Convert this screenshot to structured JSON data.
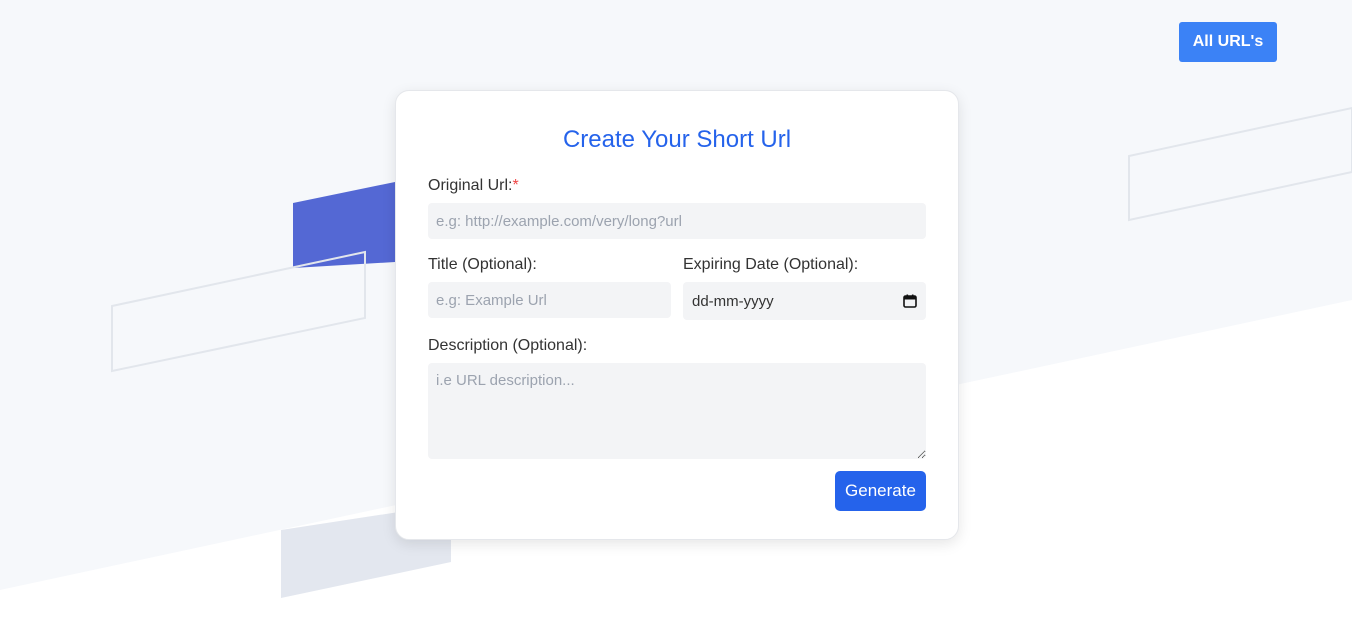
{
  "header": {
    "all_urls_label": "All URL's"
  },
  "form": {
    "title": "Create Your Short Url",
    "original_url": {
      "label": "Original Url:",
      "required_mark": "*",
      "placeholder": "e.g: http://example.com/very/long?url",
      "value": ""
    },
    "title_field": {
      "label": "Title (Optional):",
      "placeholder": "e.g: Example Url",
      "value": ""
    },
    "expiring_date": {
      "label": "Expiring Date (Optional):",
      "display_value": "dd-mm-yyyy",
      "icon": "calendar-icon"
    },
    "description": {
      "label": "Description (Optional):",
      "placeholder": "i.e URL description...",
      "value": ""
    },
    "submit_label": "Generate"
  },
  "colors": {
    "primary": "#2563eb",
    "secondary_button": "#3b82f6",
    "required": "#ef4444",
    "input_bg": "#f3f4f6",
    "accent_shape": "#5468d4"
  }
}
